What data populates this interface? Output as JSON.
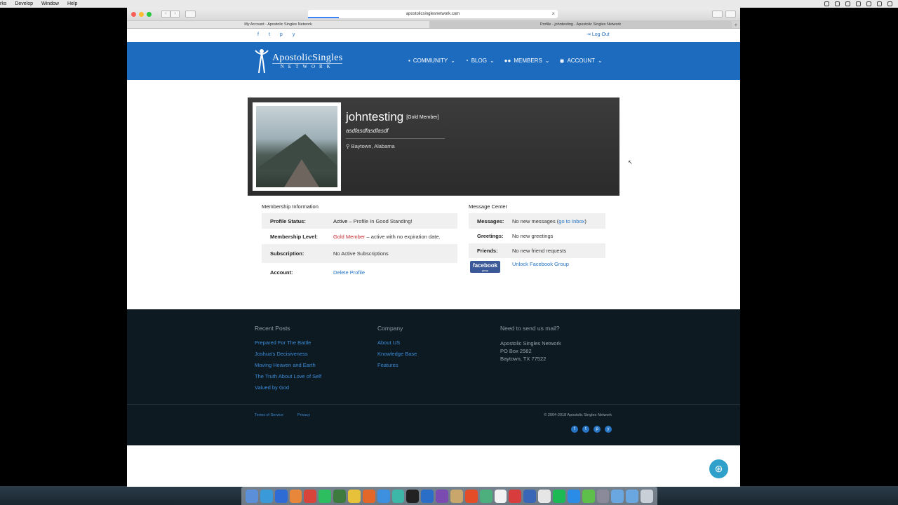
{
  "menubar": {
    "items": [
      "rks",
      "Develop",
      "Window",
      "Help"
    ]
  },
  "browser": {
    "url": "apostolicsinglesnetwork.com",
    "tabs": [
      {
        "label": "My Account - Apostolic Singles Network",
        "active": true
      },
      {
        "label": "Profile - johntesting - Apostolic Singles Network",
        "active": false
      }
    ]
  },
  "site": {
    "social_top": [
      "f",
      "t",
      "p",
      "y"
    ],
    "logout": "Log Out",
    "logo_main": "ApostolicSingles",
    "logo_sub": "NETWORK",
    "nav": [
      {
        "label": "COMMUNITY",
        "icon": "comment-icon"
      },
      {
        "label": "BLOG",
        "icon": "rss-icon"
      },
      {
        "label": "MEMBERS",
        "icon": "users-icon"
      },
      {
        "label": "ACCOUNT",
        "icon": "dashboard-icon"
      }
    ]
  },
  "profile": {
    "username": "johntesting",
    "badge": "[Gold Member]",
    "tagline": "asdfasdfasdfasdf",
    "location": "Baytown, Alabama"
  },
  "membership": {
    "heading": "Membership Information",
    "rows": [
      {
        "label": "Profile Status:",
        "value_strong": "Active",
        "value": " – Profile In Good Standing!"
      },
      {
        "label": "Membership Level:",
        "value_red": "Gold Member",
        "value": " – active with no expiration date."
      },
      {
        "label": "Subscription:",
        "value": "No Active Subscriptions"
      },
      {
        "label": "Account:",
        "link": "Delete Profile"
      }
    ]
  },
  "messages": {
    "heading": "Message Center",
    "rows": [
      {
        "label": "Messages:",
        "value": "No new messages (",
        "link": "go to Inbox",
        "value_after": ")"
      },
      {
        "label": "Greetings:",
        "value": "No new greetings"
      },
      {
        "label": "Friends:",
        "value": "No new friend requests"
      },
      {
        "fb_logo": "facebook",
        "fb_sub": "group",
        "link": "Unlock Facebook Group"
      }
    ]
  },
  "footer": {
    "recent_posts": {
      "heading": "Recent Posts",
      "links": [
        "Prepared For The Battle",
        "Joshua's Decisiveness",
        "Moving Heaven and Earth",
        "The Truth About Love of Self",
        "Valued by God"
      ]
    },
    "company": {
      "heading": "Company",
      "links": [
        "About US",
        "Knowledge Base",
        "Features"
      ]
    },
    "mail": {
      "heading": "Need to send us mail?",
      "lines": [
        "Apostolic Singles Network",
        "PO Box 2582",
        "Baytown, TX 77522"
      ]
    },
    "legal": [
      "Terms of Service",
      "Privacy"
    ],
    "copyright": "© 2004-2018 Apostolic Singles Network",
    "social_bottom": [
      "f",
      "t",
      "p",
      "y"
    ]
  },
  "colors": {
    "nav_blue": "#1c6bbf",
    "link_blue": "#2575c4",
    "gold_red": "#c4262e",
    "footer_dark": "#0e1a22",
    "help_teal": "#2ea0c9"
  }
}
